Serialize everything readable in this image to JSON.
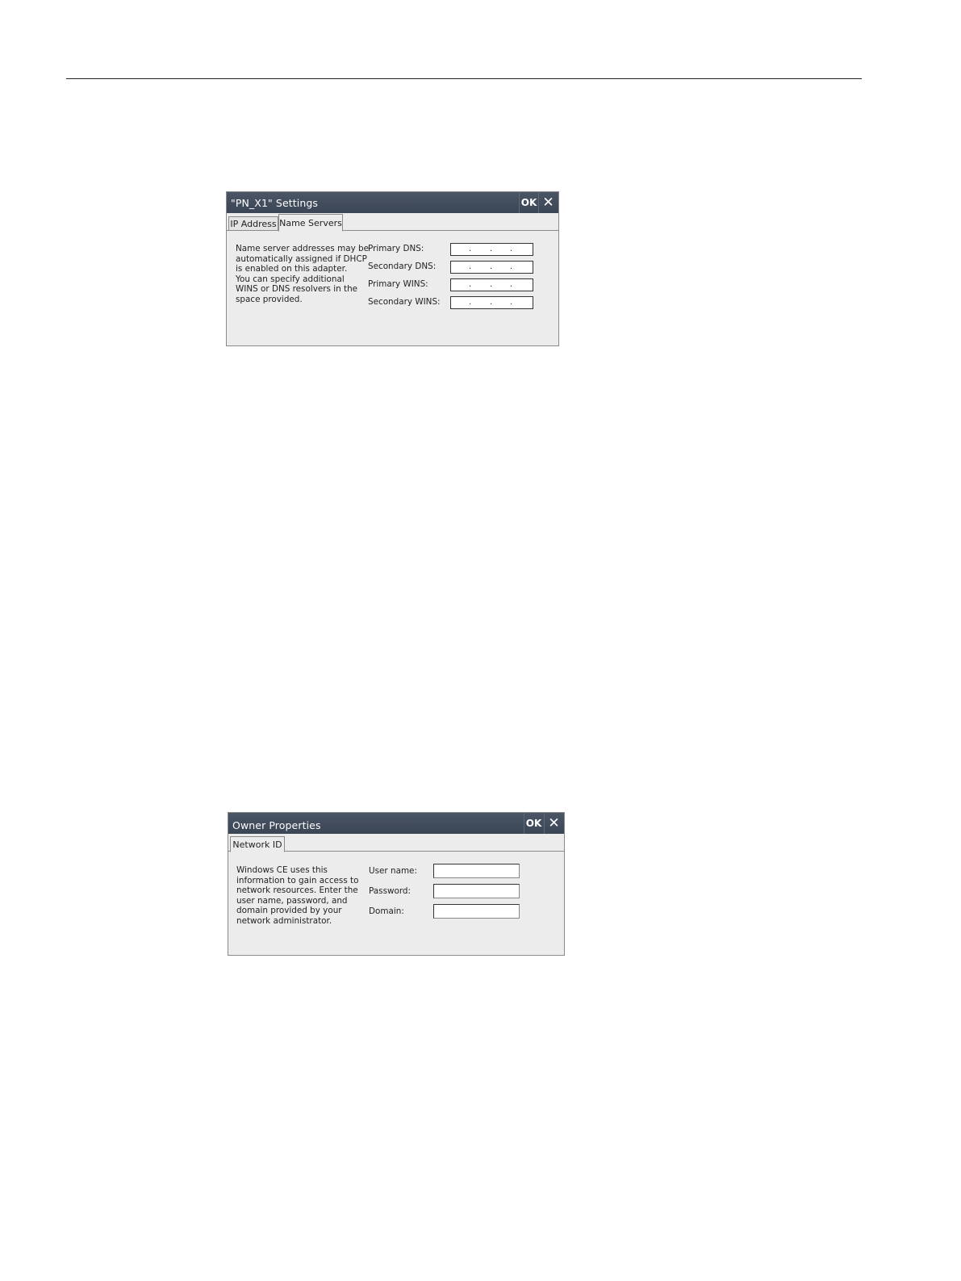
{
  "dialog_settings": {
    "title": "\"PN_X1\" Settings",
    "ok_label": "OK",
    "tabs": [
      {
        "label": "IP Address",
        "active": false
      },
      {
        "label": "Name Servers",
        "active": true
      }
    ],
    "description": "Name server addresses may be\nautomatically assigned if DHCP\nis enabled on this adapter.\nYou can specify additional\nWINS or DNS resolvers in the\nspace provided.",
    "fields": [
      {
        "label": "Primary DNS:",
        "value": ""
      },
      {
        "label": "Secondary DNS:",
        "value": ""
      },
      {
        "label": "Primary WINS:",
        "value": ""
      },
      {
        "label": "Secondary WINS:",
        "value": ""
      }
    ]
  },
  "dialog_owner": {
    "title": "Owner Properties",
    "ok_label": "OK",
    "tabs": [
      {
        "label": "Network ID",
        "active": true
      }
    ],
    "description": "Windows CE uses this\ninformation to gain access to\nnetwork resources. Enter the\nuser name, password, and\ndomain provided by your\nnetwork administrator.",
    "fields": [
      {
        "label": "User name:",
        "value": ""
      },
      {
        "label": "Password:",
        "value": ""
      },
      {
        "label": "Domain:",
        "value": ""
      }
    ]
  },
  "icons": {
    "close": "close-icon"
  },
  "colors": {
    "titlebar": "#3f4a5a",
    "dialog_background": "#ececec"
  }
}
